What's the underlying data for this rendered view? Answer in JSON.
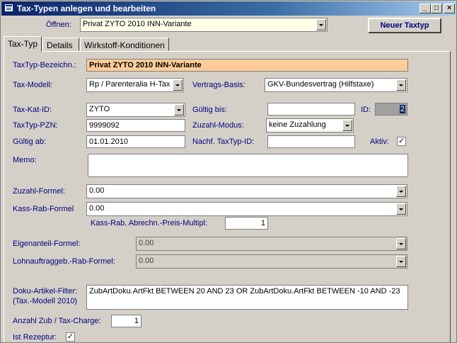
{
  "window": {
    "title": "Tax-Typen anlegen und bearbeiten",
    "min": "_",
    "max": "□",
    "close": "×"
  },
  "header": {
    "open_label": "Öffnen:",
    "open_value": "Privat ZYTO 2010 INN-Variante",
    "new_button": "Neuer Taxtyp"
  },
  "tabs": [
    "Tax-Typ",
    "Details",
    "Wirkstoff-Konditionen"
  ],
  "form": {
    "bezeichnung_label": "TaxTyp-Bezeichn.:",
    "bezeichnung_value": "Privat ZYTO 2010 INN-Variante",
    "modell_label": "Tax-Modell:",
    "modell_value": "Rp / Parenteralia H-Tax",
    "vertrag_label": "Vertrags-Basis:",
    "vertrag_value": "GKV-Bundesvertrag (Hilfstaxe)",
    "katid_label": "Tax-Kat-ID:",
    "katid_value": "ZYTO",
    "gueltigbis_label": "Gültig bis:",
    "gueltigbis_value": "",
    "id_label": "ID:",
    "id_value": "2",
    "pzn_label": "TaxTyp-PZN:",
    "pzn_value": "9999092",
    "zuzahlmodus_label": "Zuzahl-Modus:",
    "zuzahlmodus_value": "keine Zuzahlung",
    "gueltigab_label": "Gültig ab:",
    "gueltigab_value": "01.01.2010",
    "nachf_label": "Nachf. TaxTyp-ID:",
    "nachf_value": "",
    "aktiv_label": "Aktiv:",
    "aktiv_mark": "✓",
    "memo_label": "Memo:",
    "memo_value": "",
    "zuzahl_formel_label": "Zuzahl-Formel:",
    "zuzahl_formel_value": "0.00",
    "kassrab_formel_label": "Kass-Rab-Formel",
    "kassrab_formel_value": "0.00",
    "kassrab_multipl_label": "Kass-Rab. Abrechn.-Preis-Multipl:",
    "kassrab_multipl_value": "1",
    "eigenanteil_label": "Eigenanteil-Formel:",
    "eigenanteil_value": "0.00",
    "lohnauftrag_label": "Lohnauftraggeb.-Rab-Formel:",
    "lohnauftrag_value": "0.00",
    "doku_label1": "Doku-Artikel-Filter:",
    "doku_label2": "(Tax.-Modell 2010)",
    "doku_value": "ZubArtDoku.ArtFkt BETWEEN 20 AND 23 OR ZubArtDoku.ArtFkt BETWEEN -10 AND -23",
    "anzahl_label": "Anzahl Zub / Tax-Charge:",
    "anzahl_value": "1",
    "rezeptur_label": "Ist Rezeptur:",
    "rezeptur_mark": "✓"
  },
  "colors": {
    "title_start": "#0a246a",
    "window_bg": "#d4d0c8",
    "highlight_field": "#ffcc99",
    "label_blue": "#000080"
  }
}
